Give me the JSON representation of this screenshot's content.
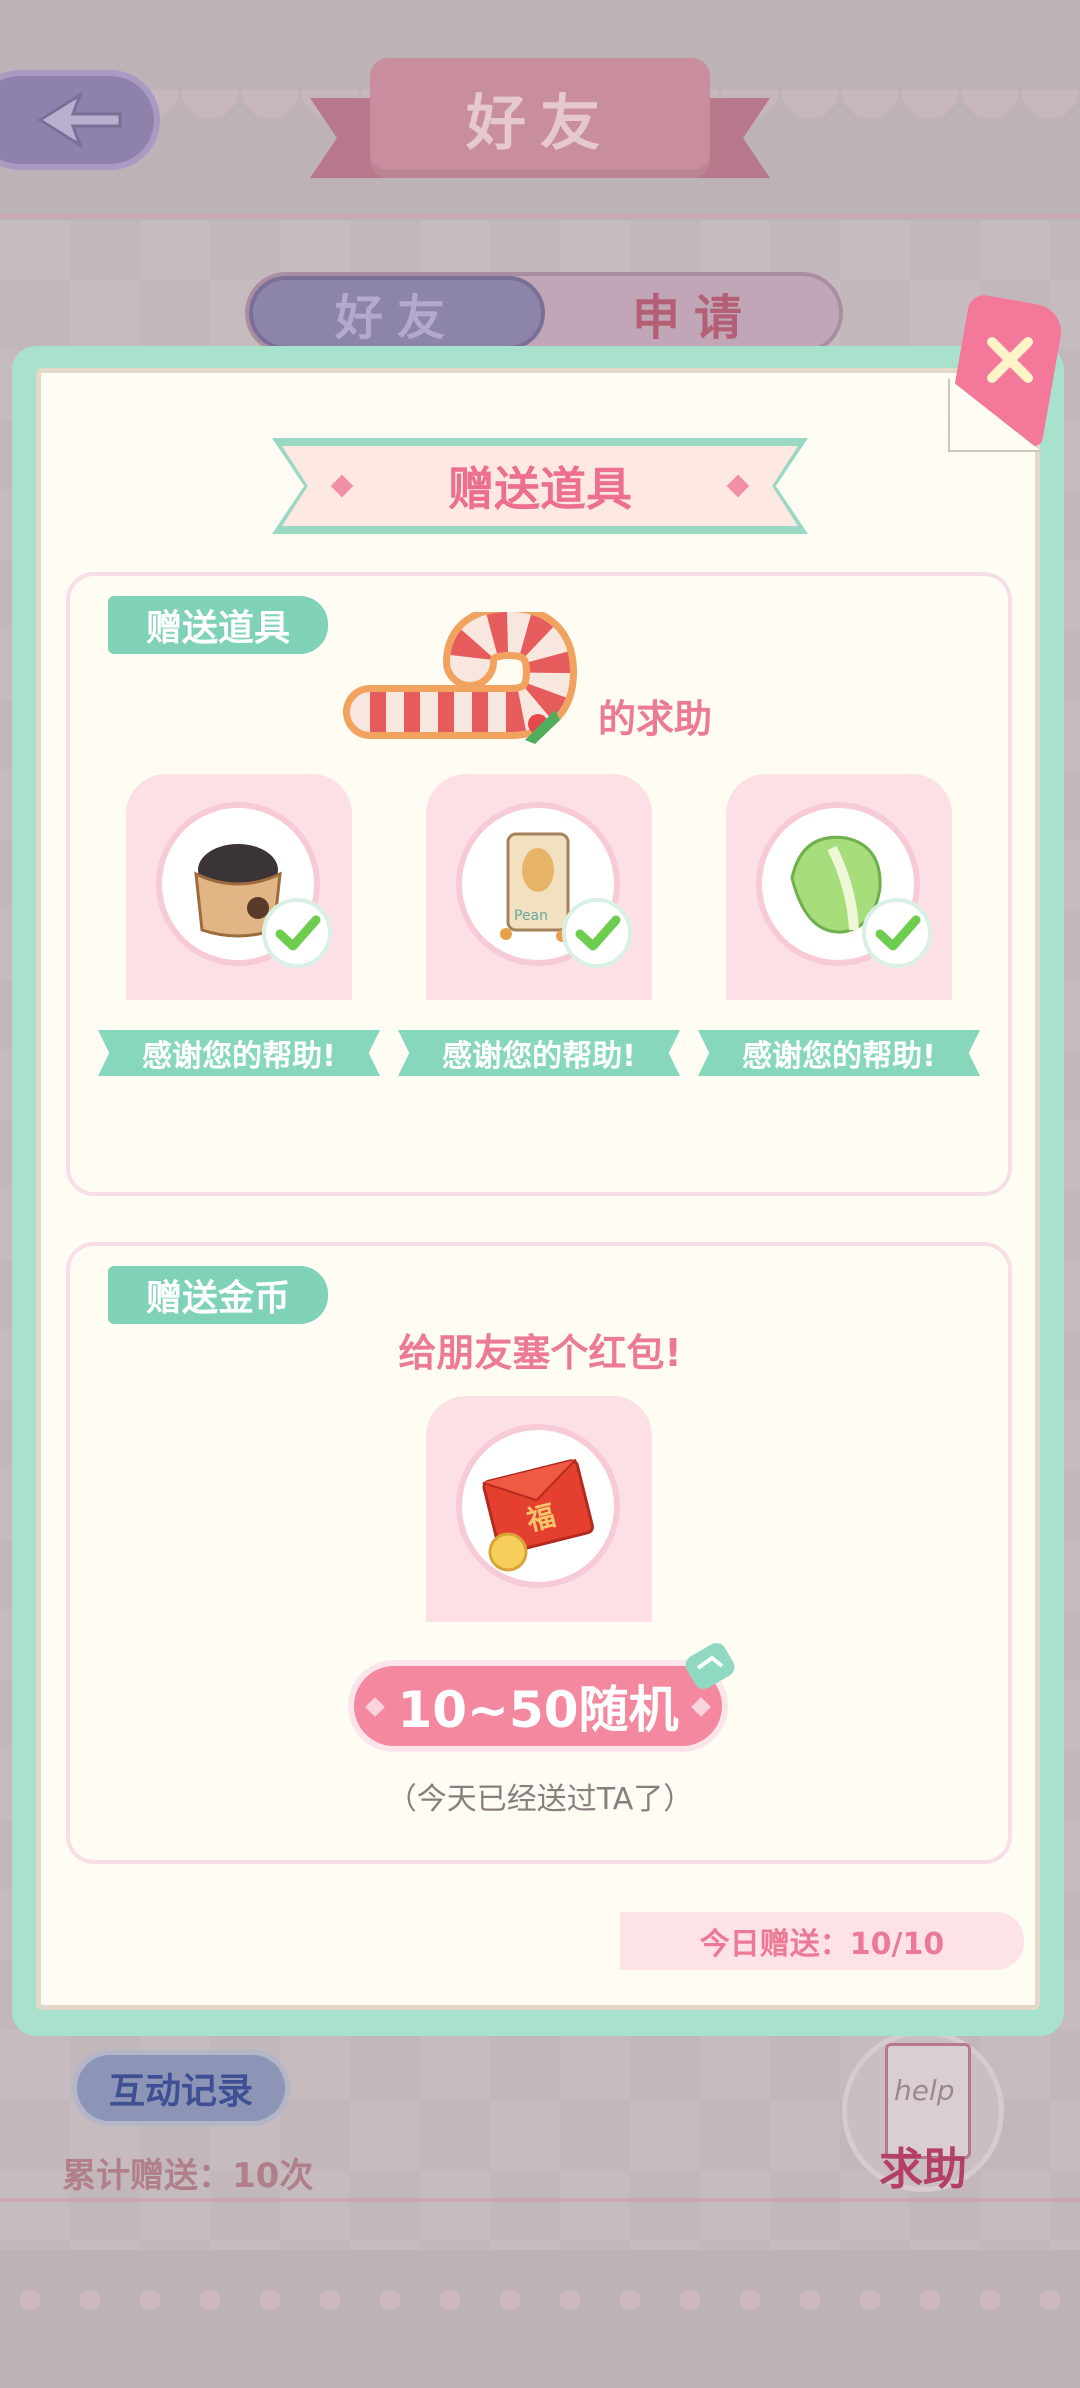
{
  "header": {
    "title": "好友",
    "back_icon": "back-arrow-icon"
  },
  "tabs": [
    {
      "label": "好友",
      "active": true
    },
    {
      "label": "申请",
      "active": false
    }
  ],
  "dialog": {
    "title": "赠送道具",
    "close_icon": "close-icon",
    "items_section": {
      "tag": "赠送道具",
      "subtitle": "的求助",
      "items": [
        {
          "name": "bag-of-dirt",
          "icon": "soil-bag-icon",
          "status": "感谢您的帮助!"
        },
        {
          "name": "peanuts",
          "icon": "peanut-bag-icon",
          "status": "感谢您的帮助!",
          "pack_label": "Pean"
        },
        {
          "name": "cabbage",
          "icon": "cabbage-icon",
          "status": "感谢您的帮助!"
        }
      ]
    },
    "coins_section": {
      "tag": "赠送金币",
      "subtitle": "给朋友塞个红包!",
      "envelope_char": "福",
      "button_label": "10~50随机",
      "note": "（今天已经送过TA了）"
    },
    "today_gift": "今日赠送：10/10"
  },
  "footer": {
    "record_button": "互动记录",
    "total_gift": "累计赠送：10次",
    "help_button": "求助",
    "help_paper_text": "help"
  },
  "colors": {
    "accent_pink": "#ec7a96",
    "mint": "#87d7bd",
    "modal_border": "#a8e2cc"
  }
}
